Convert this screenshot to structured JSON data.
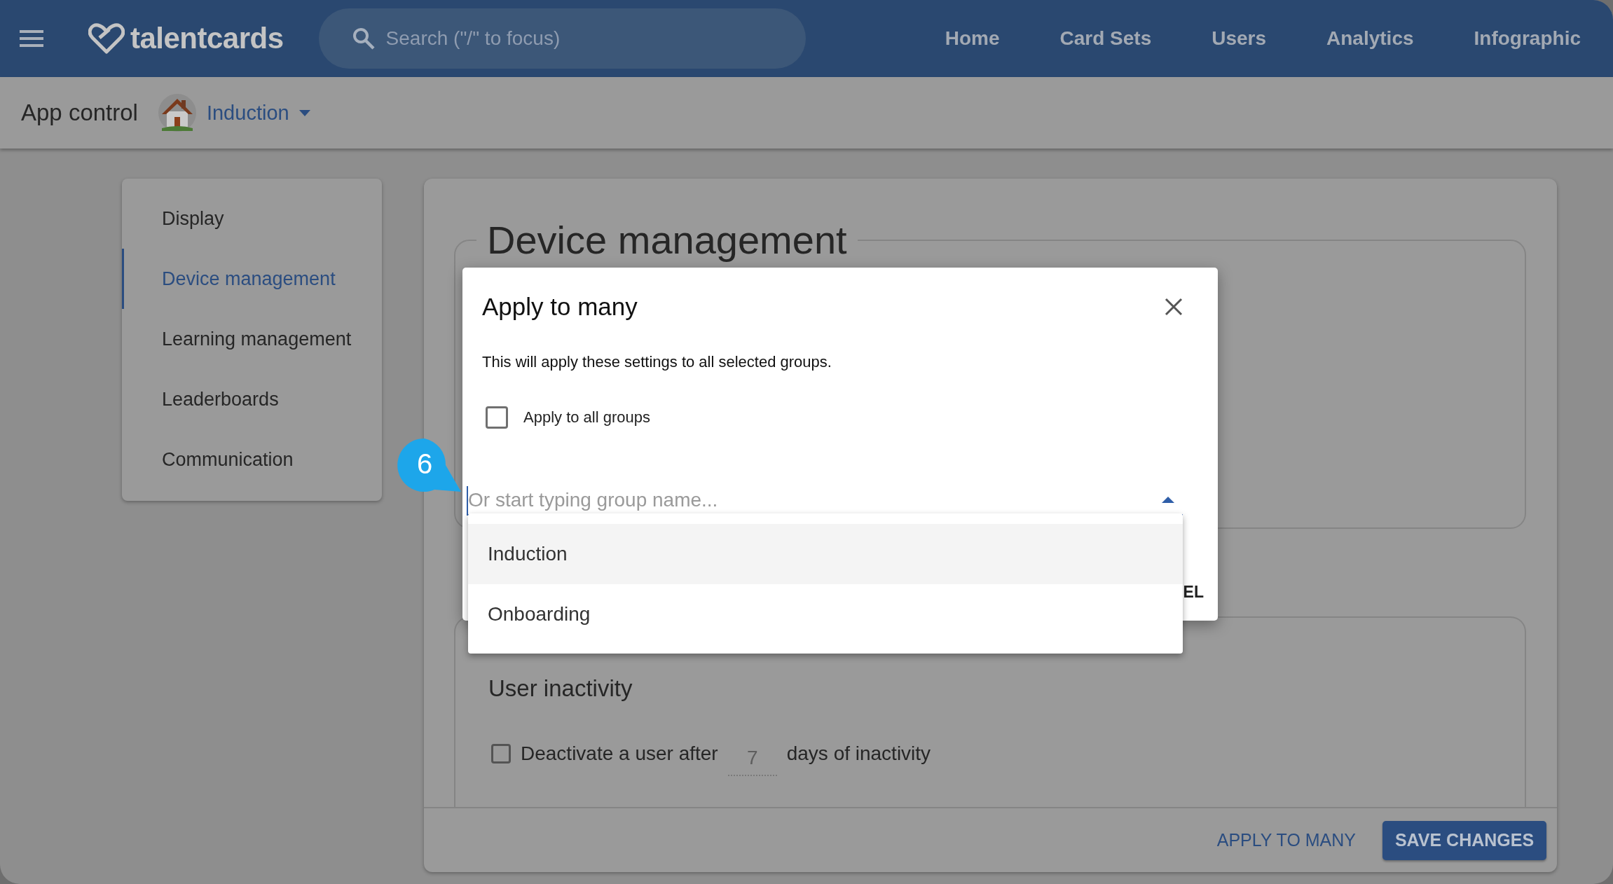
{
  "header": {
    "logo": "talentcards",
    "search": {
      "placeholder": "Search (\"/\" to focus)"
    },
    "nav": [
      {
        "label": "Home"
      },
      {
        "label": "Card Sets"
      },
      {
        "label": "Users"
      },
      {
        "label": "Analytics"
      },
      {
        "label": "Infographic"
      }
    ]
  },
  "subheader": {
    "title": "App control",
    "group": "Induction"
  },
  "sidebar": {
    "items": [
      {
        "label": "Display",
        "selected": false
      },
      {
        "label": "Device management",
        "selected": true
      },
      {
        "label": "Learning management",
        "selected": false
      },
      {
        "label": "Leaderboards",
        "selected": false
      },
      {
        "label": "Communication",
        "selected": false
      }
    ]
  },
  "main": {
    "title": "Device management",
    "inactivity": {
      "title": "User inactivity",
      "checked": false,
      "before": "Deactivate a user after",
      "placeholder": "7",
      "after": "days of inactivity"
    },
    "buttons": [
      {
        "label": "APPLY TO MANY",
        "kind": "text"
      },
      {
        "label": "SAVE CHANGES",
        "kind": "filled"
      }
    ]
  },
  "dialog": {
    "title": "Apply to many",
    "message": "This will apply these settings to all selected groups.",
    "apply_all": {
      "label": "Apply to all groups",
      "checked": false
    },
    "group_field": {
      "placeholder": "Or start typing group name...",
      "expanded": true
    },
    "options": [
      {
        "label": "Induction",
        "selected": true
      },
      {
        "label": "Onboarding",
        "selected": false
      }
    ],
    "action_fragment": "EL"
  },
  "step_badge": "6"
}
